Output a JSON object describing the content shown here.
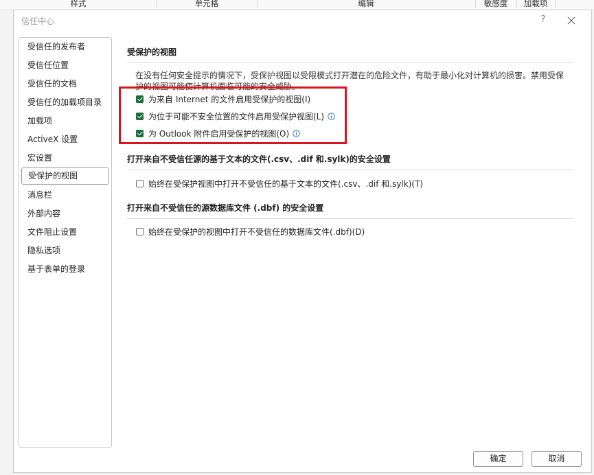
{
  "ribbon": {
    "items": [
      "样式",
      "单元格",
      "编辑",
      "敏感度",
      "加载项"
    ]
  },
  "dialog": {
    "title": "信任中心",
    "help_label": "?",
    "close_icon": "close-icon"
  },
  "sidebar": {
    "selected_index": 7,
    "items": [
      {
        "label": "受信任的发布者"
      },
      {
        "label": "受信任位置"
      },
      {
        "label": "受信任的文档"
      },
      {
        "label": "受信任的加载项目录"
      },
      {
        "label": "加载项"
      },
      {
        "label": "ActiveX 设置"
      },
      {
        "label": "宏设置"
      },
      {
        "label": "受保护的视图"
      },
      {
        "label": "消息栏"
      },
      {
        "label": "外部内容"
      },
      {
        "label": "文件阻止设置"
      },
      {
        "label": "隐私选项"
      },
      {
        "label": "基于表单的登录"
      }
    ]
  },
  "main": {
    "section1": {
      "title": "受保护的视图",
      "description": "在没有任何安全提示的情况下，受保护视图以受限模式打开潜在的危险文件，有助于最小化对计算机的损害。禁用受保护的视图可能使计算机面临可能的安全威胁。",
      "options": [
        {
          "label": "为来自 Internet 的文件启用受保护的视图(I)",
          "checked": true,
          "info": false
        },
        {
          "label": "为位于可能不安全位置的文件启用受保护视图(L)",
          "checked": true,
          "info": true
        },
        {
          "label": "为 Outlook 附件启用受保护的视图(O)",
          "checked": true,
          "info": true
        }
      ]
    },
    "section2": {
      "title": "打开来自不受信任源的基于文本的文件(.csv、.dif 和.sylk)的安全设置",
      "option": {
        "label": "始终在受保护视图中打开不受信任的基于文本的文件(.csv、.dif 和.sylk)(T)",
        "checked": false
      }
    },
    "section3": {
      "title": "打开来自不受信任的源数据库文件 (.dbf) 的安全设置",
      "option": {
        "label": "始终在受保护的视图中打开不受信任的数据库文件(.dbf)(D)",
        "checked": false
      }
    }
  },
  "footer": {
    "ok_label": "确定",
    "cancel_label": "取消"
  },
  "colors": {
    "checkbox_checked": "#1e6b3a",
    "highlight_box": "#d8141d",
    "info_icon": "#2b74c4"
  }
}
